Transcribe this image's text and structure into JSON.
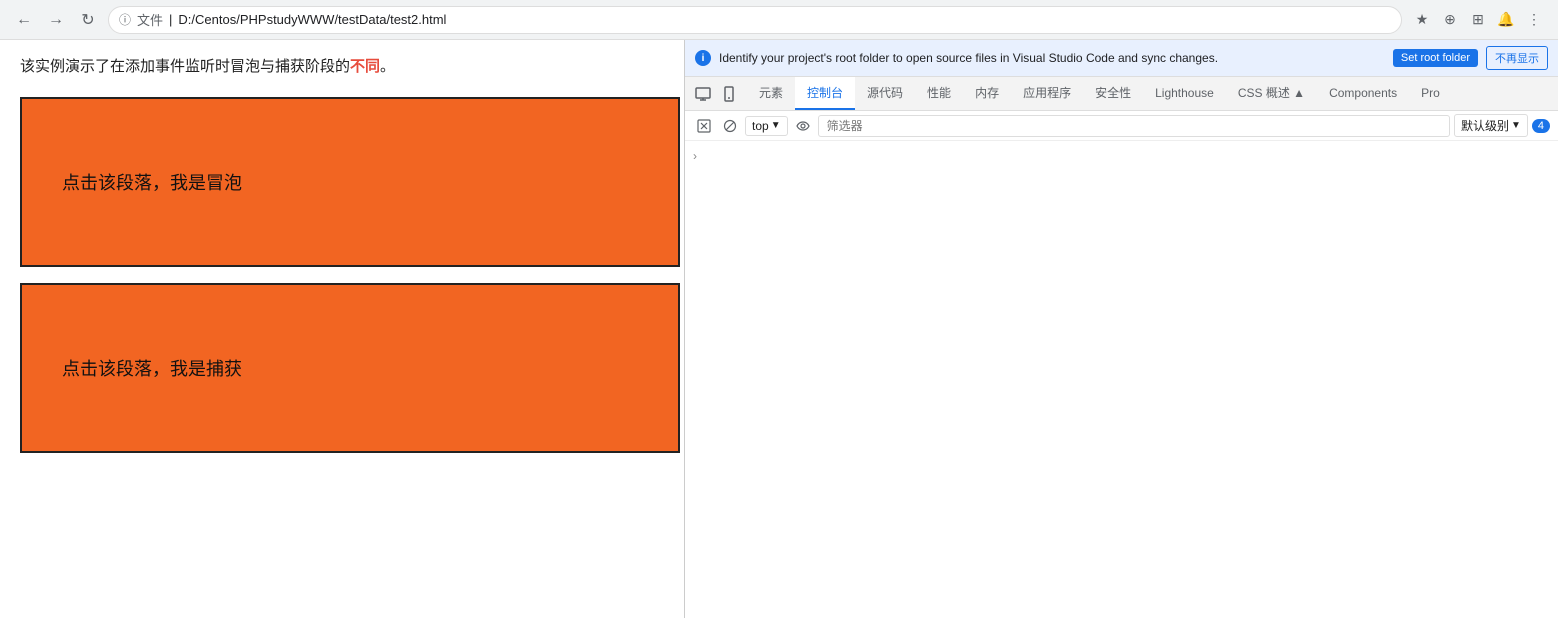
{
  "browser": {
    "back_label": "←",
    "forward_label": "→",
    "reload_label": "↻",
    "lock_label": "ⓘ",
    "file_label": "文件",
    "address": "D:/Centos/PHPstudyWWW/testData/test2.html",
    "action_icons": [
      "★",
      "⊕",
      "⊞",
      "🔔",
      "⋮"
    ]
  },
  "page": {
    "description": "该实例演示了在添加事件监听时冒泡与捕获阶段的不同。",
    "box1_text": "点击该段落，我是冒泡",
    "box2_text": "点击该段落，我是捕获"
  },
  "devtools": {
    "info_text": "Identify your project's root folder to open source files in Visual Studio Code and sync changes.",
    "set_root_label": "Set root folder",
    "dismiss_label": "不再显示",
    "tabs": [
      {
        "id": "screen",
        "label": "⬡",
        "icon": true
      },
      {
        "id": "mobile",
        "label": "⬢",
        "icon": true
      },
      {
        "id": "elements",
        "label": "元素"
      },
      {
        "id": "console",
        "label": "控制台",
        "active": true
      },
      {
        "id": "sources",
        "label": "源代码"
      },
      {
        "id": "performance",
        "label": "性能"
      },
      {
        "id": "memory",
        "label": "内存"
      },
      {
        "id": "application",
        "label": "应用程序"
      },
      {
        "id": "security",
        "label": "安全性"
      },
      {
        "id": "lighthouse",
        "label": "Lighthouse"
      },
      {
        "id": "css",
        "label": "CSS 概述 ▲"
      },
      {
        "id": "components",
        "label": "Components"
      },
      {
        "id": "pro",
        "label": "Pro"
      }
    ],
    "console": {
      "toolbar": {
        "clear_icon": "🚫",
        "ban_icon": "⊘",
        "top_label": "top",
        "dropdown_arrow": "▼",
        "eye_icon": "👁",
        "filter_placeholder": "筛选器",
        "level_label": "默认级别",
        "level_arrow": "▼",
        "badge_count": "4"
      }
    }
  }
}
